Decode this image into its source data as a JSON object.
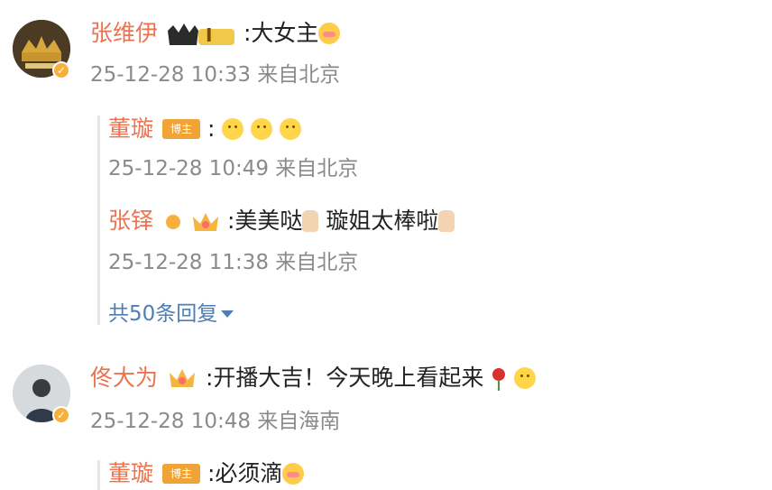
{
  "comments": [
    {
      "user": "张维伊",
      "text": ":大女主",
      "meta": "25-12-28 10:33 来自北京",
      "level": "I",
      "replies": [
        {
          "user": "董璇",
          "badge": "博主",
          "text": ":",
          "meta": "25-12-28 10:49 来自北京"
        },
        {
          "user": "张铎",
          "text": ":美美哒",
          "text2": "璇姐太棒啦",
          "meta": "25-12-28 11:38 来自北京"
        }
      ],
      "more_replies": "共50条回复"
    },
    {
      "user": "佟大为",
      "text": ":开播大吉！今天晚上看起来",
      "meta": "25-12-28 10:48 来自海南",
      "replies": [
        {
          "user": "董璇",
          "badge": "博主",
          "text": ":必须滴"
        }
      ]
    }
  ],
  "colors": {
    "name": "#eb7350",
    "text": "#222222",
    "meta": "#8a8a8a",
    "link": "#4f7db5",
    "badge": "#f0a336",
    "verified": "#f6b03b"
  }
}
